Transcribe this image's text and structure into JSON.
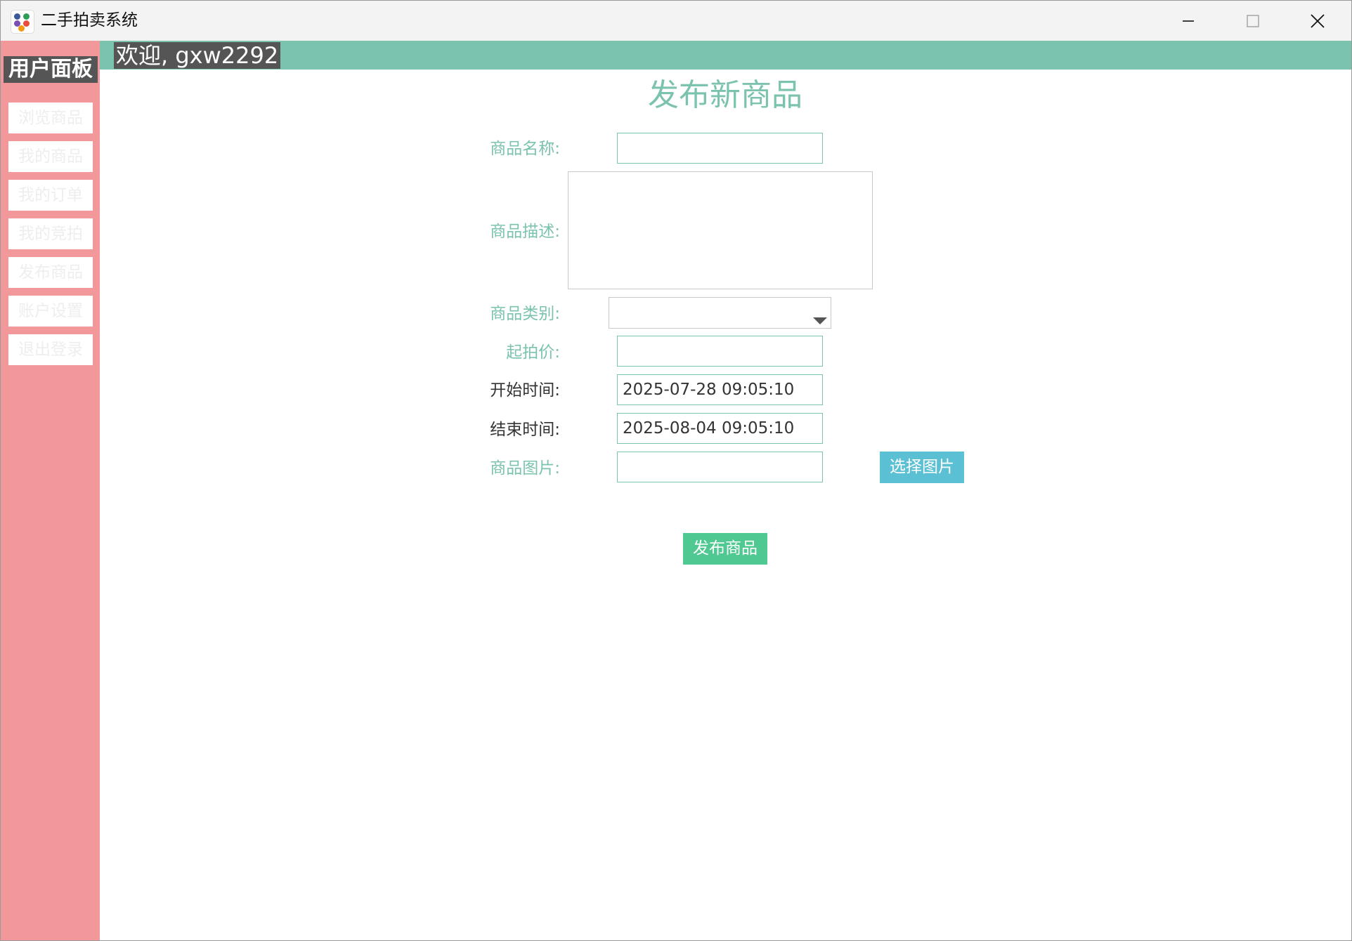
{
  "window": {
    "title": "二手拍卖系统",
    "controls": {
      "minimize": "minimize-icon",
      "maximize": "maximize-icon",
      "close": "close-icon"
    }
  },
  "sidebar": {
    "title": "用户面板",
    "items": [
      {
        "label": "浏览商品"
      },
      {
        "label": "我的商品"
      },
      {
        "label": "我的订单"
      },
      {
        "label": "我的竞拍"
      },
      {
        "label": "发布商品"
      },
      {
        "label": "账户设置"
      },
      {
        "label": "退出登录"
      }
    ]
  },
  "header": {
    "welcome": "欢迎, gxw2292"
  },
  "form": {
    "title": "发布新商品",
    "name_label": "商品名称:",
    "name_value": "",
    "description_label": "商品描述:",
    "description_value": "",
    "category_label": "商品类别:",
    "category_value": "",
    "price_label": "起拍价:",
    "price_value": "",
    "start_label": "开始时间:",
    "start_value": "2025-07-28 09:05:10",
    "end_label": "结束时间:",
    "end_value": "2025-08-04 09:05:10",
    "image_label": "商品图片:",
    "image_value": "",
    "choose_image_button": "选择图片",
    "submit_button": "发布商品"
  },
  "colors": {
    "accent": "#7bc3ae",
    "sidebar": "#f2989a",
    "choose_button": "#5bc0d3",
    "submit_button": "#4fc891",
    "dark_label_bg": "#555555"
  }
}
